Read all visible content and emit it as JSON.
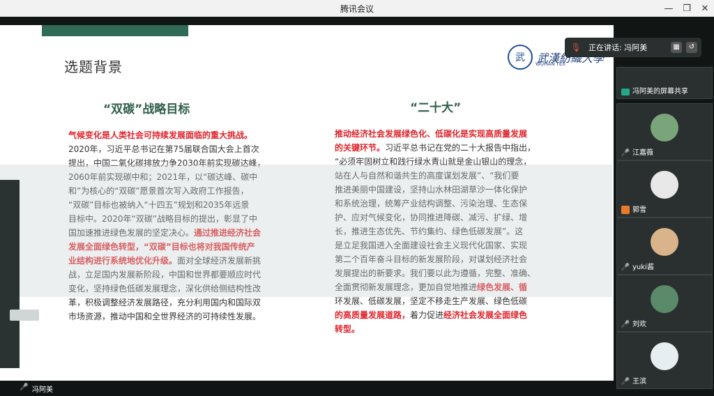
{
  "window": {
    "title": "腾讯会议",
    "buttons": [
      "—",
      "❐",
      "✕"
    ]
  },
  "slide": {
    "heading": "选题背景",
    "logo_cn": "武漢紡織大學",
    "logo_en": "WUHAN TEX",
    "left_title": "“双碳”战略目标",
    "right_title": "“二十大”",
    "left_paragraph": [
      {
        "t": "气候变化是人类社会可持续发展面临的重大挑战。",
        "red": true
      },
      {
        "t": "2020年，习近平总书记在第75届联合国大会上首次",
        "red": false
      },
      {
        "t": "提出，中国二氧化碳排放力争2030年前实现碳达峰，",
        "red": false
      },
      {
        "t": "2060年前实现碳中和；2021年，以“碳达峰、碳中",
        "red": false
      },
      {
        "t": "和”为核心的“双碳”愿景首次写入政府工作报告，",
        "red": false
      },
      {
        "t": "“双碳”目标也被纳入“十四五”规划和2035年远景",
        "red": false
      },
      {
        "t": "目标中。2020年“双碳”战略目标的提出，彰显了中",
        "red": false
      },
      {
        "t": "国加速推进绿色发展的坚定决心。",
        "red": false,
        "tail_red": "通过推进经济社会"
      },
      {
        "t": "发展全面绿色转型，“双碳”目标也将对我国传统产",
        "red": true
      },
      {
        "t": "业结构进行系统地优化升级。",
        "red": true,
        "tail": "面对全球经济发展新挑"
      },
      {
        "t": "战，立足国内发展新阶段，中国和世界都要顺应时代",
        "red": false
      },
      {
        "t": "变化，坚持绿色低碳发展理念，深化供给侧结构性改",
        "red": false
      },
      {
        "t": "革，积极调整经济发展路径，充分利用国内和国际双",
        "red": false
      },
      {
        "t": "市场资源，推动中国和全世界经济的可持续性发展。",
        "red": false
      }
    ],
    "right_paragraph": [
      {
        "t": "推动经济社会发展绿色化、低碳化是实现高质量发展",
        "red": true
      },
      {
        "t": "的关键环节。",
        "red": true,
        "tail": "习近平总书记在党的二十大报告中指出，"
      },
      {
        "t": "“必须牢固树立和践行绿水青山就是金山银山的理念，",
        "red": false
      },
      {
        "t": "站在人与自然和谐共生的高度谋划发展”、“我们要",
        "red": false
      },
      {
        "t": "推进美丽中国建设，坚持山水林田湖草沙一体化保护",
        "red": false
      },
      {
        "t": "和系统治理，统筹产业结构调整、污染治理、生态保",
        "red": false
      },
      {
        "t": "护、应对气候变化，协同推进降碳、减污、扩绿、增",
        "red": false
      },
      {
        "t": "长，推进生态优先、节约集约、绿色低碳发展”。这",
        "red": false
      },
      {
        "t": "是立足我国进入全面建设社会主义现代化国家、实现",
        "red": false
      },
      {
        "t": "第二个百年奋斗目标的新发展阶段，对谋划经济社会",
        "red": false
      },
      {
        "t": "发展提出的新要求。我们要以此为遵循，完整、准确、",
        "red": false
      },
      {
        "t": "全面贯彻新发展理念，更加自觉地推进",
        "red": false,
        "tail_red": "绿色发展、循"
      },
      {
        "t": "环发展、低碳发展，坚定不移走生产发展、绿色低碳",
        "red": false
      },
      {
        "t": "的高质量发展道路，",
        "red": true,
        "tail": "着力促进",
        "tail_red2": "经济社会发展全面绿色"
      },
      {
        "t": "转型。",
        "red": true
      }
    ]
  },
  "speaker": {
    "label": "正在讲话: 冯阿美"
  },
  "participants": [
    {
      "name": "冯阿美的屏幕共享",
      "avatar_color": "#1b1f1f"
    },
    {
      "name": "江嘉薇",
      "avatar_color": "#7aa57a"
    },
    {
      "name": "郭雪",
      "avatar_color": "#e8e8e8"
    },
    {
      "name": "yuki酱",
      "avatar_color": "#d9b48a"
    },
    {
      "name": "刘欢",
      "avatar_color": "#5a8a6a"
    },
    {
      "name": "王滨",
      "avatar_color": "#e6eef2"
    }
  ],
  "self": {
    "name": "冯阿美"
  }
}
